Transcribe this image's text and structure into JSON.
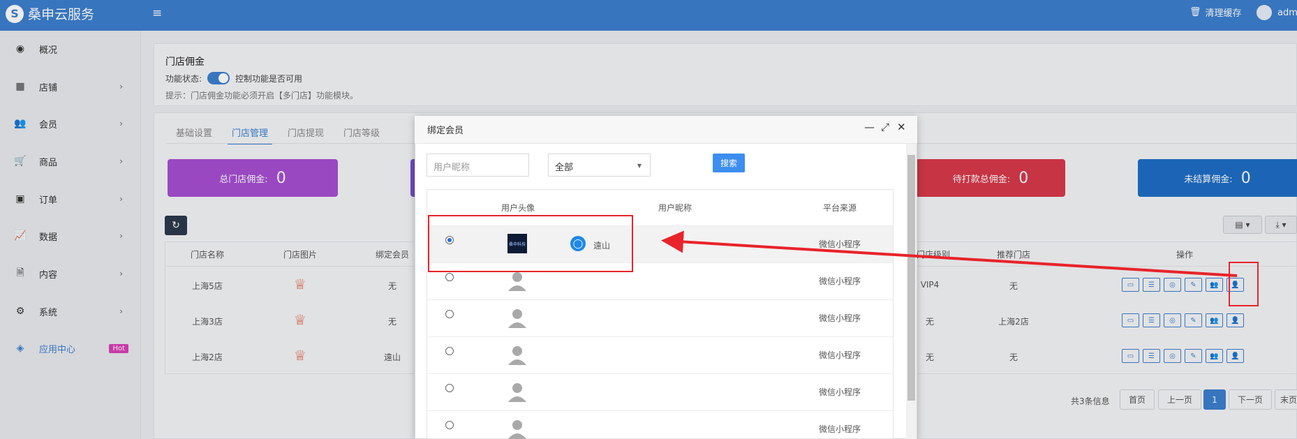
{
  "topbar": {
    "brand": "桑申云服务",
    "logo_glyph": "S",
    "menu_icon": "hamburger-icon",
    "cache_label": "清理缓存",
    "user_label": "adm"
  },
  "sidebar": {
    "items": [
      {
        "label": "概况",
        "icon": "dashboard-icon",
        "glyph": "◉",
        "chev": ""
      },
      {
        "label": "店铺",
        "icon": "grid-icon",
        "glyph": "▦",
        "chev": "›"
      },
      {
        "label": "会员",
        "icon": "users-icon",
        "glyph": "👥",
        "chev": "›"
      },
      {
        "label": "商品",
        "icon": "cart-icon",
        "glyph": "🛒",
        "chev": "›"
      },
      {
        "label": "订单",
        "icon": "money-icon",
        "glyph": "▣",
        "chev": "›"
      },
      {
        "label": "数据",
        "icon": "chart-icon",
        "glyph": "📈",
        "chev": "›"
      },
      {
        "label": "内容",
        "icon": "file-icon",
        "glyph": "🗎",
        "chev": "›"
      },
      {
        "label": "系统",
        "icon": "gear-icon",
        "glyph": "⚙",
        "chev": "›"
      },
      {
        "label": "应用中心",
        "icon": "cube-icon",
        "glyph": "◈",
        "chev": ""
      }
    ],
    "hot_badge": "Hot"
  },
  "settings": {
    "title": "门店佣金",
    "status_label": "功能状态:",
    "status_desc": "控制功能是否可用",
    "hint": "提示：门店佣金功能必须开启【多门店】功能模块。",
    "toggle_on": true
  },
  "tabs": [
    "基础设置",
    "门店管理",
    "门店提现",
    "门店等级"
  ],
  "stats": [
    {
      "label": "总门店佣金:",
      "value": "0",
      "color": "#a74fd3"
    },
    {
      "label": "待打款总佣金:",
      "value": "0",
      "color": "#d8394a"
    },
    {
      "label": "未结算佣金:",
      "value": "0",
      "color": "#1f6ec6"
    }
  ],
  "table": {
    "headers": [
      "门店名称",
      "门店图片",
      "绑定会员",
      "门店级别",
      "推荐门店",
      "操作"
    ],
    "rows": [
      {
        "name": "上海5店",
        "member": "无",
        "level": "VIP4",
        "ref": "无"
      },
      {
        "name": "上海3店",
        "member": "无",
        "level": "无",
        "ref": "上海2店"
      },
      {
        "name": "上海2店",
        "member": "遠山",
        "level": "无",
        "ref": "无"
      }
    ],
    "crown_glyph": "♕",
    "op_glyphs": [
      "▭",
      "☰",
      "◎",
      "✎",
      "👥",
      "👤"
    ]
  },
  "toolbar": {
    "refresh_glyph": "↻",
    "columns_glyph": "▤ ▾",
    "export_glyph": "⤓ ▾"
  },
  "pagination": {
    "info": "共3条信息",
    "first": "首页",
    "prev": "上一页",
    "current": "1",
    "next": "下一页",
    "last": "末页"
  },
  "modal": {
    "title": "绑定会员",
    "controls": {
      "min": "—",
      "max": "⤢",
      "close": "✕"
    },
    "search_placeholder": "用户昵称",
    "select_value": "全部",
    "select_caret": "▼",
    "search_button": "搜索",
    "headers": [
      "用户头像",
      "用户昵称",
      "平台来源"
    ],
    "avatar_caption": "桑申科技",
    "rows": [
      {
        "selected": true,
        "avatar": "image",
        "nickname": "遠山",
        "source": "微信小程序"
      },
      {
        "selected": false,
        "avatar": "default",
        "nickname": "",
        "source": "微信小程序"
      },
      {
        "selected": false,
        "avatar": "default",
        "nickname": "",
        "source": "微信小程序"
      },
      {
        "selected": false,
        "avatar": "default",
        "nickname": "",
        "source": "微信小程序"
      },
      {
        "selected": false,
        "avatar": "default",
        "nickname": "",
        "source": "微信小程序"
      },
      {
        "selected": false,
        "avatar": "default",
        "nickname": "",
        "source": "微信小程序"
      }
    ]
  },
  "annotation": {
    "color": "#e8232a"
  }
}
